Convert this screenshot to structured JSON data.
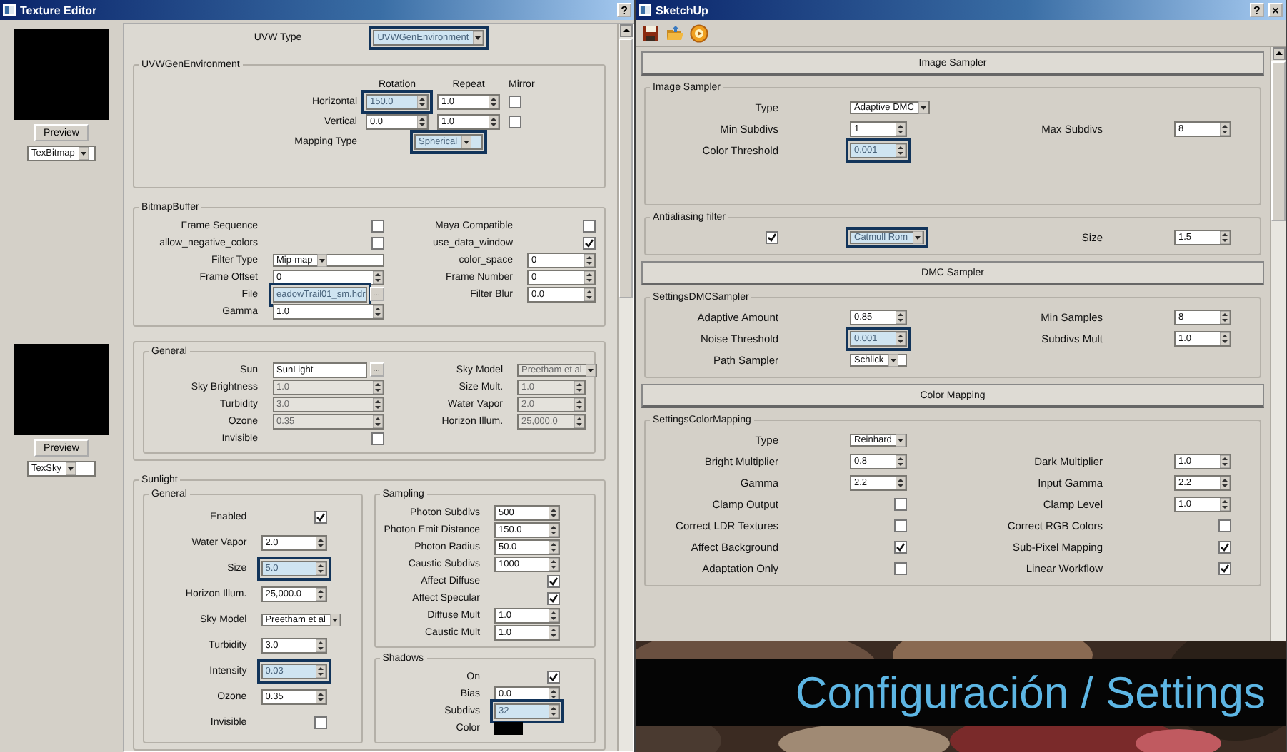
{
  "texture_editor": {
    "title": "Texture Editor",
    "title_buttons": [
      "?"
    ],
    "previews": [
      {
        "button": "Preview",
        "dropdown": "TexBitmap"
      },
      {
        "button": "Preview",
        "dropdown": "TexSky"
      }
    ],
    "uvw_type": {
      "label": "UVW Type",
      "kind": "dropdown",
      "value": "UVWGenEnvironment",
      "highlighted": true
    },
    "groups": [
      {
        "kind": "table",
        "title": "UVWGenEnvironment",
        "headers": [
          "Rotation",
          "Repeat",
          "Mirror"
        ],
        "rows": [
          [
            {
              "label": "Horizontal",
              "kind": "spin",
              "value": "150.0",
              "highlighted": true
            },
            {
              "kind": "spin",
              "value": "1.0"
            },
            {
              "kind": "check",
              "checked": false
            }
          ],
          [
            {
              "label": "Vertical",
              "kind": "spin",
              "value": "0.0"
            },
            {
              "kind": "spin",
              "value": "1.0"
            },
            {
              "kind": "check",
              "checked": false
            }
          ],
          [
            {
              "label": "Mapping Type",
              "kind": "dropdown",
              "value": "Spherical",
              "highlighted": true
            }
          ]
        ]
      },
      {
        "kind": "form",
        "title": "BitmapBuffer",
        "rows": [
          [
            {
              "label": "Frame Sequence",
              "kind": "check",
              "checked": false
            },
            {
              "label": "Maya Compatible",
              "kind": "check",
              "checked": false
            }
          ],
          [
            {
              "label": "allow_negative_colors",
              "kind": "check",
              "checked": false
            },
            {
              "label": "use_data_window",
              "kind": "check",
              "checked": true
            }
          ],
          [
            {
              "label": "Filter Type",
              "kind": "dropdown",
              "value": "Mip-map"
            },
            {
              "label": "color_space",
              "kind": "spin",
              "value": "0"
            }
          ],
          [
            {
              "label": "Frame Offset",
              "kind": "spin",
              "value": "0"
            },
            {
              "label": "Frame Number",
              "kind": "spin",
              "value": "0"
            }
          ],
          [
            {
              "label": "File",
              "kind": "text",
              "value": "eadowTrail01_sm.hdr",
              "button": "...",
              "highlighted": true
            },
            {
              "label": "Filter Blur",
              "kind": "spin",
              "value": "0.0"
            }
          ],
          [
            {
              "label": "Gamma",
              "kind": "spin",
              "value": "1.0"
            }
          ]
        ]
      },
      {
        "kind": "split",
        "columns": [
          [
            {
              "kind": "form",
              "title": "General",
              "rows": [
                [
                  {
                    "label": "Sun",
                    "kind": "text",
                    "value": "SunLight",
                    "button": "..."
                  },
                  {
                    "label": "Sky Model",
                    "kind": "dropdown",
                    "value": "Preetham et al",
                    "disabled": true
                  }
                ],
                [
                  {
                    "label": "Sky Brightness",
                    "kind": "spin",
                    "value": "1.0",
                    "disabled": true
                  },
                  {
                    "label": "Size Mult.",
                    "kind": "spin",
                    "value": "1.0",
                    "disabled": true
                  }
                ],
                [
                  {
                    "label": "Turbidity",
                    "kind": "spin",
                    "value": "3.0",
                    "disabled": true
                  },
                  {
                    "label": "Water Vapor",
                    "kind": "spin",
                    "value": "2.0",
                    "disabled": true
                  }
                ],
                [
                  {
                    "label": "Ozone",
                    "kind": "spin",
                    "value": "0.35",
                    "disabled": true
                  },
                  {
                    "label": "Horizon Illum.",
                    "kind": "spin",
                    "value": "25,000.0",
                    "disabled": true
                  }
                ],
                [
                  {
                    "label": "Invisible",
                    "kind": "check",
                    "checked": false
                  }
                ]
              ]
            }
          ]
        ]
      },
      {
        "kind": "split",
        "title": "Sunlight",
        "columns": [
          [
            {
              "kind": "form",
              "title": "General",
              "rows": [
                [
                  {
                    "label": "Enabled",
                    "kind": "check",
                    "checked": true
                  }
                ],
                [
                  {
                    "label": "Water Vapor",
                    "kind": "spin",
                    "value": "2.0"
                  }
                ],
                [
                  {
                    "label": "Size",
                    "kind": "spin",
                    "value": "5.0",
                    "highlighted": true
                  }
                ],
                [
                  {
                    "label": "Horizon Illum.",
                    "kind": "spin",
                    "value": "25,000.0"
                  }
                ],
                [
                  {
                    "label": "Sky Model",
                    "kind": "dropdown",
                    "value": "Preetham et al"
                  }
                ],
                [
                  {
                    "label": "Turbidity",
                    "kind": "spin",
                    "value": "3.0"
                  }
                ],
                [
                  {
                    "label": "Intensity",
                    "kind": "spin",
                    "value": "0.03",
                    "highlighted": true
                  }
                ],
                [
                  {
                    "label": "Ozone",
                    "kind": "spin",
                    "value": "0.35"
                  }
                ],
                [
                  {
                    "label": "Invisible",
                    "kind": "check",
                    "checked": false
                  }
                ]
              ]
            }
          ],
          [
            {
              "kind": "form",
              "title": "Sampling",
              "rows": [
                [
                  {
                    "label": "Photon Subdivs",
                    "kind": "spin",
                    "value": "500"
                  }
                ],
                [
                  {
                    "label": "Photon Emit Distance",
                    "kind": "spin",
                    "value": "150.0"
                  }
                ],
                [
                  {
                    "label": "Photon Radius",
                    "kind": "spin",
                    "value": "50.0"
                  }
                ],
                [
                  {
                    "label": "Caustic Subdivs",
                    "kind": "spin",
                    "value": "1000"
                  }
                ],
                [
                  {
                    "label": "Affect Diffuse",
                    "kind": "check",
                    "checked": true
                  }
                ],
                [
                  {
                    "label": "Affect Specular",
                    "kind": "check",
                    "checked": true
                  }
                ],
                [
                  {
                    "label": "Diffuse Mult",
                    "kind": "spin",
                    "value": "1.0"
                  }
                ],
                [
                  {
                    "label": "Caustic Mult",
                    "kind": "spin",
                    "value": "1.0"
                  }
                ]
              ]
            },
            {
              "kind": "form",
              "title": "Shadows",
              "rows": [
                [
                  {
                    "label": "On",
                    "kind": "check",
                    "checked": true
                  }
                ],
                [
                  {
                    "label": "Bias",
                    "kind": "spin",
                    "value": "0.0"
                  }
                ],
                [
                  {
                    "label": "Subdivs",
                    "kind": "spin",
                    "value": "32",
                    "highlighted": true
                  }
                ],
                [
                  {
                    "label": "Color",
                    "kind": "color",
                    "color": "#000000"
                  }
                ]
              ]
            }
          ]
        ]
      }
    ]
  },
  "options_window": {
    "title": "SketchUp",
    "title_buttons": [
      "?",
      "×"
    ],
    "rollouts": [
      {
        "title": "Image Sampler",
        "groups": [
          {
            "kind": "form",
            "title": "Image Sampler",
            "rows": [
              [
                {
                  "label": "Type",
                  "kind": "dropdown",
                  "value": "Adaptive DMC"
                }
              ],
              [
                {
                  "label": "Min Subdivs",
                  "kind": "spin",
                  "value": "1"
                },
                {
                  "label": "Max Subdivs",
                  "kind": "spin",
                  "value": "8"
                }
              ],
              [
                {
                  "label": "Color Threshold",
                  "kind": "spin",
                  "value": "0.001",
                  "highlighted": true
                }
              ]
            ]
          },
          {
            "kind": "form",
            "title": "Antialiasing filter",
            "rows": [
              [
                {
                  "kind": "dropdown",
                  "value": "Catmull Rom",
                  "highlighted": true,
                  "toggle": {
                    "checked": true
                  }
                },
                {
                  "label": "Size",
                  "kind": "spin",
                  "value": "1.5"
                }
              ]
            ]
          }
        ]
      },
      {
        "title": "DMC Sampler",
        "groups": [
          {
            "kind": "form",
            "title": "SettingsDMCSampler",
            "rows": [
              [
                {
                  "label": "Adaptive Amount",
                  "kind": "spin",
                  "value": "0.85"
                },
                {
                  "label": "Min Samples",
                  "kind": "spin",
                  "value": "8"
                }
              ],
              [
                {
                  "label": "Noise Threshold",
                  "kind": "spin",
                  "value": "0.001",
                  "highlighted": true
                },
                {
                  "label": "Subdivs Mult",
                  "kind": "spin",
                  "value": "1.0"
                }
              ],
              [
                {
                  "label": "Path Sampler",
                  "kind": "dropdown",
                  "value": "Schlick"
                }
              ]
            ]
          }
        ]
      },
      {
        "title": "Color Mapping",
        "groups": [
          {
            "kind": "form",
            "title": "SettingsColorMapping",
            "rows": [
              [
                {
                  "label": "Type",
                  "kind": "dropdown",
                  "value": "Reinhard"
                }
              ],
              [
                {
                  "label": "Bright Multiplier",
                  "kind": "spin",
                  "value": "0.8"
                },
                {
                  "label": "Dark Multiplier",
                  "kind": "spin",
                  "value": "1.0"
                }
              ],
              [
                {
                  "label": "Gamma",
                  "kind": "spin",
                  "value": "2.2"
                },
                {
                  "label": "Input Gamma",
                  "kind": "spin",
                  "value": "2.2"
                }
              ],
              [
                {
                  "label": "Clamp Output",
                  "kind": "check",
                  "checked": false
                },
                {
                  "label": "Clamp Level",
                  "kind": "spin",
                  "value": "1.0"
                }
              ],
              [
                {
                  "label": "Correct LDR Textures",
                  "kind": "check",
                  "checked": false
                },
                {
                  "label": "Correct RGB Colors",
                  "kind": "check",
                  "checked": false
                }
              ],
              [
                {
                  "label": "Affect Background",
                  "kind": "check",
                  "checked": true
                },
                {
                  "label": "Sub-Pixel Mapping",
                  "kind": "check",
                  "checked": true
                }
              ],
              [
                {
                  "label": "Adaptation Only",
                  "kind": "check",
                  "checked": false
                },
                {
                  "label": "Linear Workflow",
                  "kind": "check",
                  "checked": true
                }
              ]
            ]
          }
        ]
      }
    ]
  },
  "overlay": {
    "kind": "picture",
    "caption": "Configuración / Settings"
  }
}
